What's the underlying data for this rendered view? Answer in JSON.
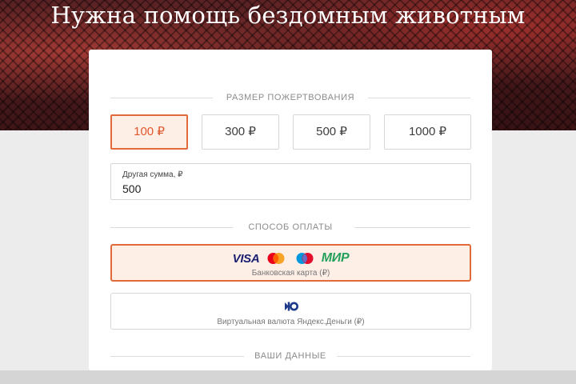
{
  "hero": {
    "title": "Нужна помощь бездомным животным"
  },
  "donation": {
    "section_title": "РАЗМЕР ПОЖЕРТВОВАНИЯ",
    "amounts": [
      {
        "label": "100 ₽",
        "selected": true
      },
      {
        "label": "300 ₽",
        "selected": false
      },
      {
        "label": "500 ₽",
        "selected": false
      },
      {
        "label": "1000 ₽",
        "selected": false
      }
    ],
    "other_amount": {
      "label": "Другая сумма, ₽",
      "value": "500"
    }
  },
  "payment": {
    "section_title": "СПОСОБ ОПЛАТЫ",
    "methods": [
      {
        "caption": "Банковская карта (₽)",
        "selected": true,
        "visa_text": "VISA",
        "mir_text": "МИР",
        "icons": [
          "visa-logo",
          "mastercard-icon",
          "maestro-icon",
          "mir-logo"
        ]
      },
      {
        "caption": "Виртуальная валюта Яндекс.Деньги (₽)",
        "selected": false,
        "icons": [
          "yandex-money-icon"
        ]
      }
    ]
  },
  "your_data": {
    "section_title": "ВАШИ ДАННЫЕ"
  },
  "colors": {
    "accent": "#e06a3a",
    "accent_bg": "#fdeee6",
    "accent_text": "#e0572d",
    "visa": "#1a1f71",
    "mir": "#23a05a",
    "yandex": "#1e3a8a"
  }
}
